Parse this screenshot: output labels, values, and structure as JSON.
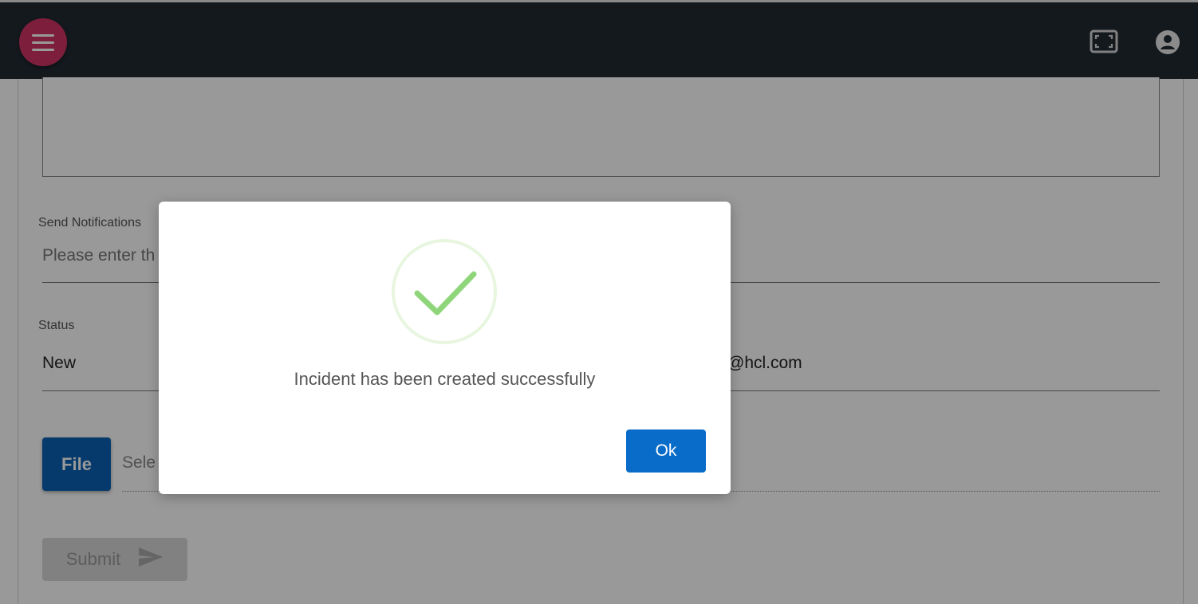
{
  "header": {
    "menu_icon": "hamburger-menu-icon",
    "fullscreen_icon": "fullscreen-icon",
    "account_icon": "account-circle-icon",
    "brand_color": "#d03464",
    "bar_color": "#222a33"
  },
  "form": {
    "notifications": {
      "label": "Send Notifications",
      "placeholder": "Please enter th"
    },
    "status": {
      "label": "Status",
      "value": "New"
    },
    "email_partial": "@hcl.com",
    "file": {
      "button_label": "File",
      "input_text": "Sele"
    },
    "submit": {
      "label": "Submit",
      "icon": "send-icon"
    }
  },
  "dialog": {
    "icon": "success-check-icon",
    "message": "Incident has been created successfully",
    "ok_label": "Ok",
    "accent_color": "#0a6cc9",
    "success_color": "#8fd67a"
  }
}
